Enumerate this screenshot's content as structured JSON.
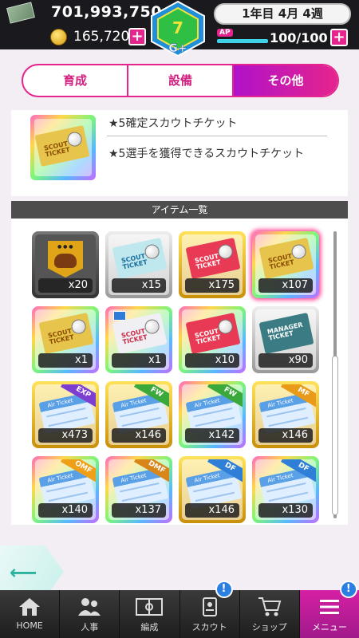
{
  "header": {
    "money": "701,993,750",
    "coins": "165,720",
    "date": "1年目 4月 4週",
    "ap_label": "AP",
    "ap": "100/100",
    "ap_fraction": 1.0,
    "rank_label": "G+",
    "plus_label": "+"
  },
  "tabs": [
    {
      "label": "育成",
      "active": false
    },
    {
      "label": "設備",
      "active": false
    },
    {
      "label": "その他",
      "active": true
    }
  ],
  "detail": {
    "name": "★5確定スカウトチケット",
    "description": "★5選手を獲得できるスカウトチケット"
  },
  "list": {
    "title": "アイテム一覧",
    "items": [
      {
        "count": "x20",
        "icon": "croissant-emblem-icon"
      },
      {
        "count": "x15",
        "icon": "scout-ticket-silver-icon"
      },
      {
        "count": "x175",
        "icon": "scout-ticket-red-icon"
      },
      {
        "count": "x107",
        "icon": "scout-ticket-5star-icon"
      },
      {
        "count": "x1",
        "icon": "scout-ticket-gold-icon"
      },
      {
        "count": "x1",
        "icon": "scout-ticket-white-icon"
      },
      {
        "count": "x10",
        "icon": "scout-ticket-red-icon"
      },
      {
        "count": "x90",
        "icon": "manager-scout-ticket-icon"
      },
      {
        "count": "x473",
        "icon": "air-ticket-icon",
        "tag": "EXP"
      },
      {
        "count": "x146",
        "icon": "air-ticket-icon",
        "tag": "FW"
      },
      {
        "count": "x142",
        "icon": "air-ticket-icon",
        "tag": "FW"
      },
      {
        "count": "x146",
        "icon": "air-ticket-icon",
        "tag": "MF"
      },
      {
        "count": "x140",
        "icon": "air-ticket-icon",
        "tag": "OMF"
      },
      {
        "count": "x137",
        "icon": "air-ticket-icon",
        "tag": "DMF"
      },
      {
        "count": "x146",
        "icon": "air-ticket-icon",
        "tag": "DF"
      },
      {
        "count": "x130",
        "icon": "air-ticket-icon",
        "tag": "DF"
      }
    ]
  },
  "nav": [
    {
      "label": "HOME",
      "icon": "home-icon"
    },
    {
      "label": "人事",
      "icon": "people-icon"
    },
    {
      "label": "編成",
      "icon": "field-icon"
    },
    {
      "label": "スカウト",
      "icon": "scout-icon",
      "badge": "!"
    },
    {
      "label": "ショップ",
      "icon": "cart-icon"
    },
    {
      "label": "メニュー",
      "icon": "menu-icon",
      "badge": "!",
      "active": true
    }
  ],
  "colors": {
    "accent": "#e5248d",
    "active_tab": "#b012c9",
    "badge": "#2a7fe0",
    "ap_bar": "#3fd3e8"
  }
}
